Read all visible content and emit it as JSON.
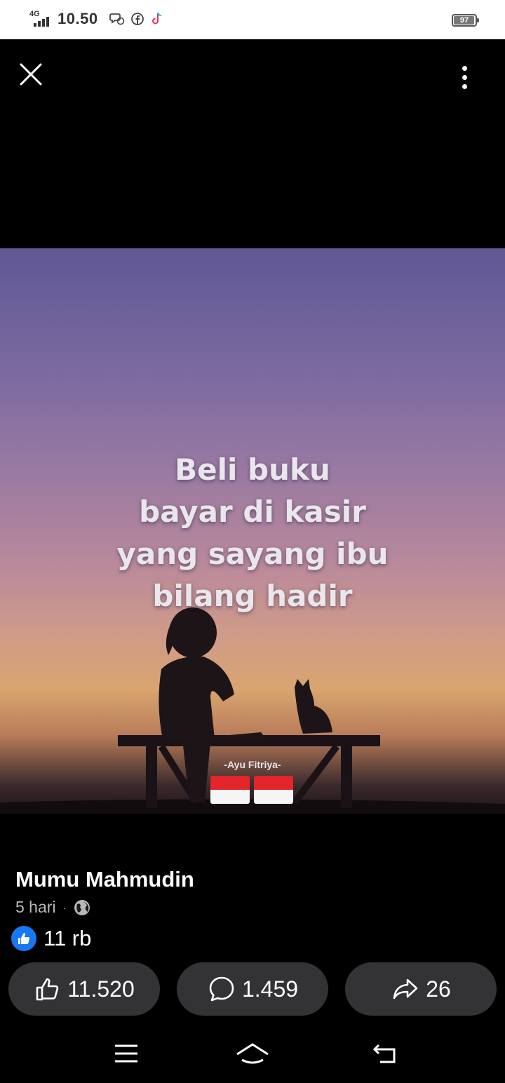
{
  "status_bar": {
    "network": "4G",
    "time": "10.50",
    "notification_icons": [
      "messenger-icon",
      "facebook-icon",
      "tiktok-icon"
    ],
    "battery": "97",
    "battery_percent": 97
  },
  "top_controls": {
    "close_icon": "close-icon",
    "more_icon": "more-vertical-icon"
  },
  "photo": {
    "caption_lines": [
      "Beli buku",
      "bayar di kasir",
      "yang sayang ibu",
      "bilang hadir"
    ],
    "watermark": "-Ayu Fitriya-",
    "flags": [
      "indonesia-flag",
      "indonesia-flag"
    ]
  },
  "post": {
    "author": "Mumu Mahmudin",
    "time_ago": "5 hari",
    "separator": "·",
    "privacy_icon": "globe-icon",
    "reaction_icon": "like-reaction-icon",
    "reaction_count": "11 rb"
  },
  "actions": {
    "like_count": "11.520",
    "comment_count": "1.459",
    "share_count": "26"
  },
  "navigation": [
    "menu-icon",
    "home-icon",
    "back-icon"
  ],
  "colors": {
    "facebook_blue": "#1877f2",
    "action_button_bg": "#333335",
    "flag_red": "#e2262c"
  }
}
